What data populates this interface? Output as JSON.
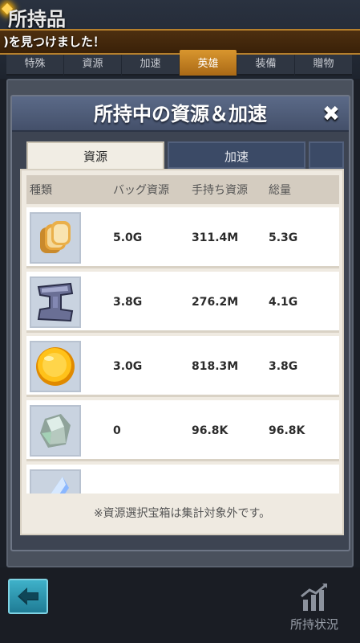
{
  "background": {
    "title": "所持品",
    "notice": ")を見つけました！",
    "tabs": [
      {
        "label": "特殊"
      },
      {
        "label": "資源"
      },
      {
        "label": "加速"
      },
      {
        "label": "英雄"
      },
      {
        "label": "装備"
      },
      {
        "label": "贈物"
      }
    ],
    "active_tab": "英雄"
  },
  "modal": {
    "title": "所持中の資源＆加速",
    "close_icon": "close-icon",
    "tabs": [
      {
        "label": "資源",
        "active": true
      },
      {
        "label": "加速",
        "active": false
      }
    ],
    "table": {
      "headers": {
        "kind": "種類",
        "bag": "バッグ資源",
        "hand": "手持ち資源",
        "total": "総量"
      },
      "rows": [
        {
          "icon": "bread-icon",
          "bag": "5.0G",
          "hand": "311.4M",
          "total": "5.3G"
        },
        {
          "icon": "iron-ingot-icon",
          "bag": "3.8G",
          "hand": "276.2M",
          "total": "4.1G"
        },
        {
          "icon": "gold-coin-icon",
          "bag": "3.0G",
          "hand": "818.3M",
          "total": "3.8G"
        },
        {
          "icon": "stone-icon",
          "bag": "0",
          "hand": "96.8K",
          "total": "96.8K"
        },
        {
          "icon": "crystal-icon",
          "bag": "",
          "hand": "",
          "total": ""
        }
      ]
    },
    "footnote": "※資源選択宝箱は集計対象外です。"
  },
  "bottom": {
    "back_icon": "back-arrow-icon",
    "status_label": "所持状況",
    "status_icon": "chart-icon"
  },
  "colors": {
    "accent_orange": "#d9962e",
    "header_blue": "#5b6a88",
    "back_button": "#2f9ab3"
  }
}
